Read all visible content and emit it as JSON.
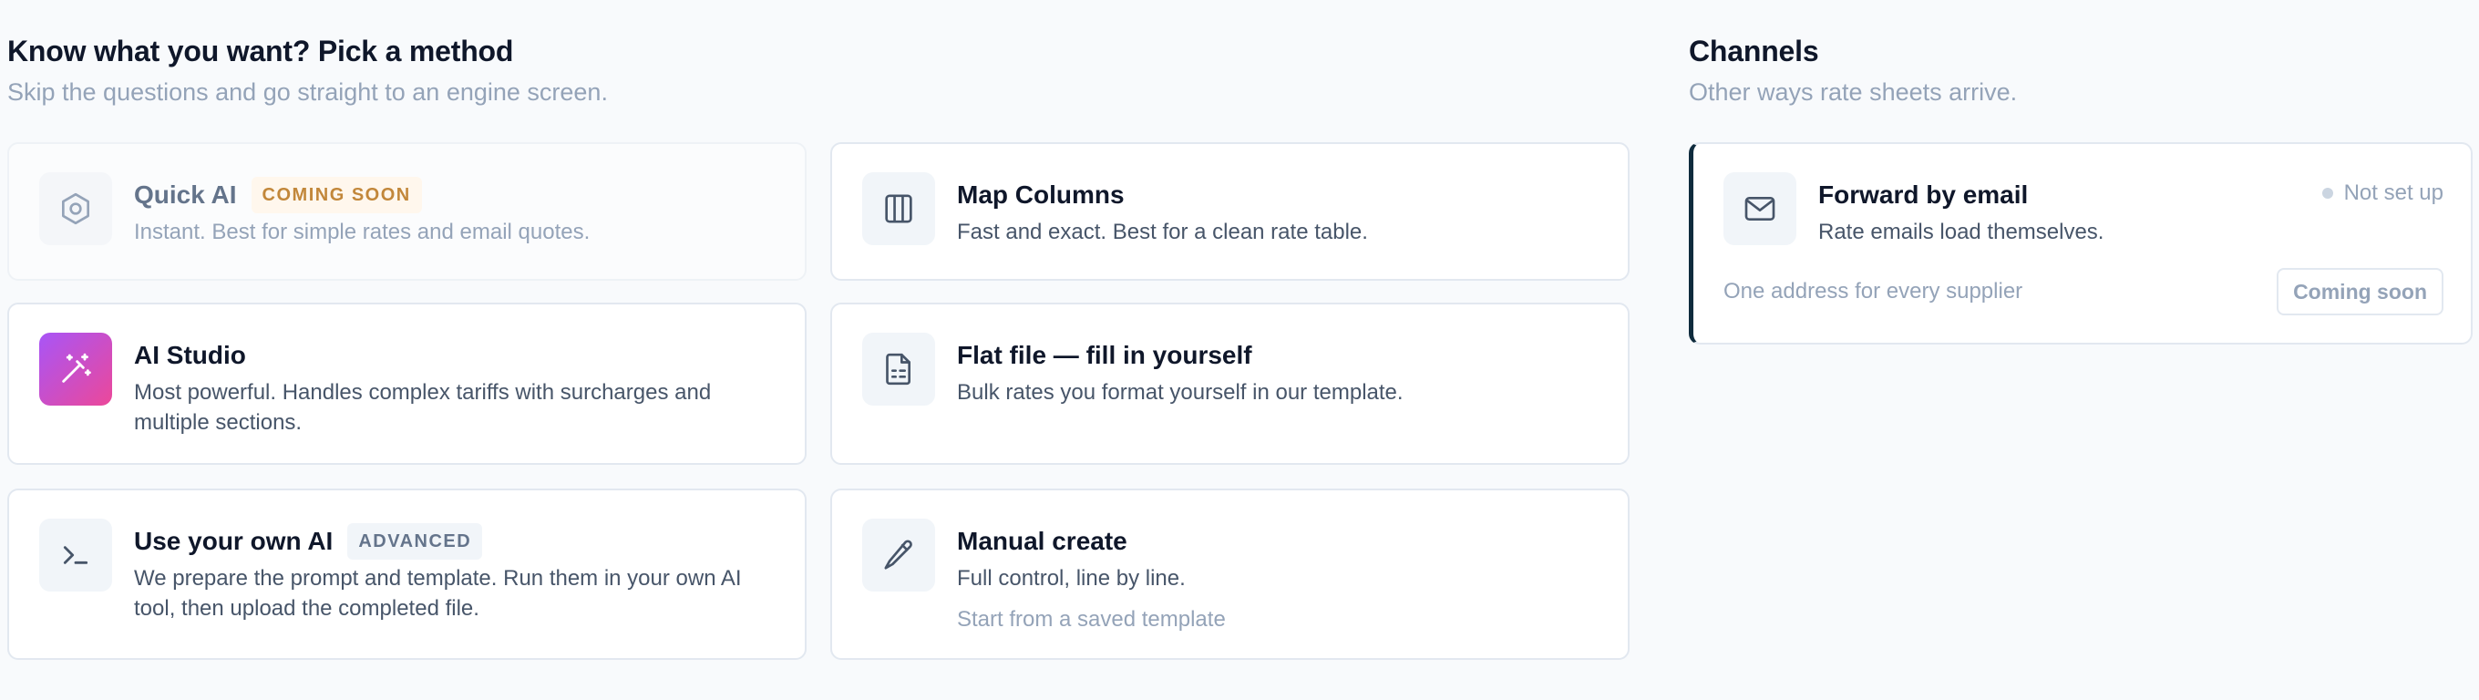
{
  "methods": {
    "heading": "Know what you want? Pick a method",
    "subheading": "Skip the questions and go straight to an engine screen.",
    "quick_ai": {
      "title": "Quick AI",
      "badge": "COMING SOON",
      "desc": "Instant. Best for simple rates and email quotes.",
      "icon": "hexagon-settings-icon"
    },
    "map_columns": {
      "title": "Map Columns",
      "desc": "Fast and exact. Best for a clean rate table.",
      "icon": "columns-icon"
    },
    "ai_studio": {
      "title": "AI Studio",
      "desc": "Most powerful. Handles complex tariffs with surcharges and multiple sections.",
      "icon": "magic-wand-icon"
    },
    "flat_file": {
      "title": "Flat file — fill in yourself",
      "desc": "Bulk rates you format yourself in our template.",
      "icon": "file-spreadsheet-icon"
    },
    "own_ai": {
      "title": "Use your own AI",
      "badge": "ADVANCED",
      "desc": "We prepare the prompt and template. Run them in your own AI tool, then upload the completed file.",
      "icon": "terminal-icon"
    },
    "manual": {
      "title": "Manual create",
      "desc": "Full control, line by line.",
      "extra": "Start from a saved template",
      "icon": "pencil-icon"
    }
  },
  "channels": {
    "heading": "Channels",
    "subheading": "Other ways rate sheets arrive.",
    "email": {
      "title": "Forward by email",
      "desc": "Rate emails load themselves.",
      "status": "Not set up",
      "footer": "One address for every supplier",
      "button": "Coming soon",
      "icon": "mail-icon"
    }
  },
  "colors": {
    "accent_gradient_start": "#a855f7",
    "accent_gradient_end": "#ec4899",
    "channel_accent": "#0f2b3d",
    "badge_soon_text": "#c2873a"
  }
}
